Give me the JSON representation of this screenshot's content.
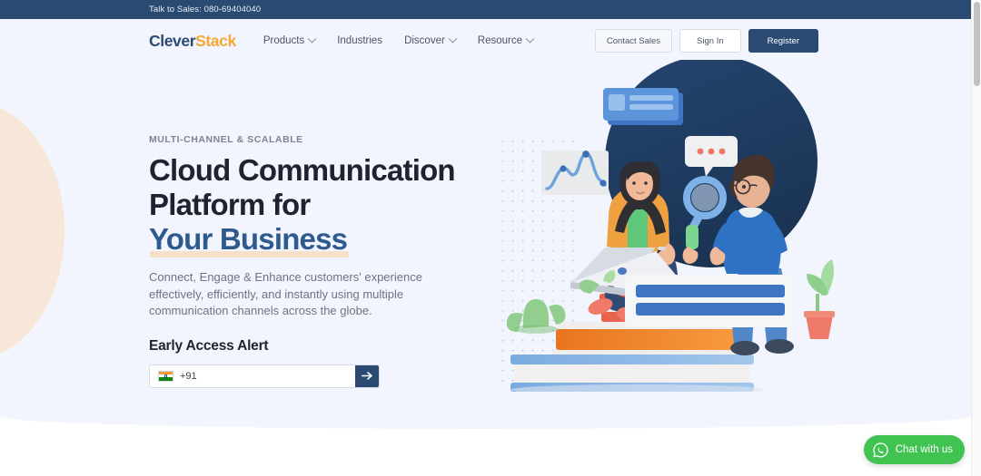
{
  "topbar": {
    "sales_text": "Talk to Sales: 080-69404040",
    "bg_color": "#2a4a72"
  },
  "nav": {
    "logo": {
      "part1": "Clever",
      "part2": "Stack",
      "color1": "#2a4a72",
      "color2": "#f5a833"
    },
    "links": [
      {
        "label": "Products",
        "has_chevron": true
      },
      {
        "label": "Industries",
        "has_chevron": false
      },
      {
        "label": "Discover",
        "has_chevron": true
      },
      {
        "label": "Resource",
        "has_chevron": true
      }
    ],
    "actions": {
      "contact_sales": "Contact Sales",
      "sign_in": "Sign In",
      "register": "Register"
    }
  },
  "hero": {
    "eyebrow": "MULTI-CHANNEL & SCALABLE",
    "headline_line1": "Cloud Communication",
    "headline_line2_prefix": "Platform for ",
    "headline_accent": "Your Business",
    "accent_color": "#2e5a8e",
    "accent_underline_color": "#f7e0c8",
    "subcopy": "Connect, Engage & Enhance customers' experience effectively, efficiently, and instantly using multiple communication channels across the globe.",
    "cta_label": "Early Access Alert",
    "phone": {
      "country_flag": "india-flag-icon",
      "country_code": "+91",
      "placeholder": "",
      "submit_icon": "arrow-right-icon"
    },
    "background_color": "#f2f5fd",
    "decorative_circle_color": "#f7e7d8"
  },
  "illustration": {
    "name": "cloud-communication-hero-illustration",
    "circle_color": "#1e3a5f",
    "elements": [
      "ui-card-top",
      "chat-bubble",
      "analytics-chart-card",
      "woman-with-laptop",
      "man-with-magnifier",
      "stacked-books",
      "cactus",
      "potted-plant",
      "dot-grid-pattern"
    ]
  },
  "chat_widget": {
    "label": "Chat with us",
    "icon": "whatsapp-icon",
    "color": "#41c352"
  },
  "scrollbar": {
    "thumb_color": "#c2c2c2"
  }
}
